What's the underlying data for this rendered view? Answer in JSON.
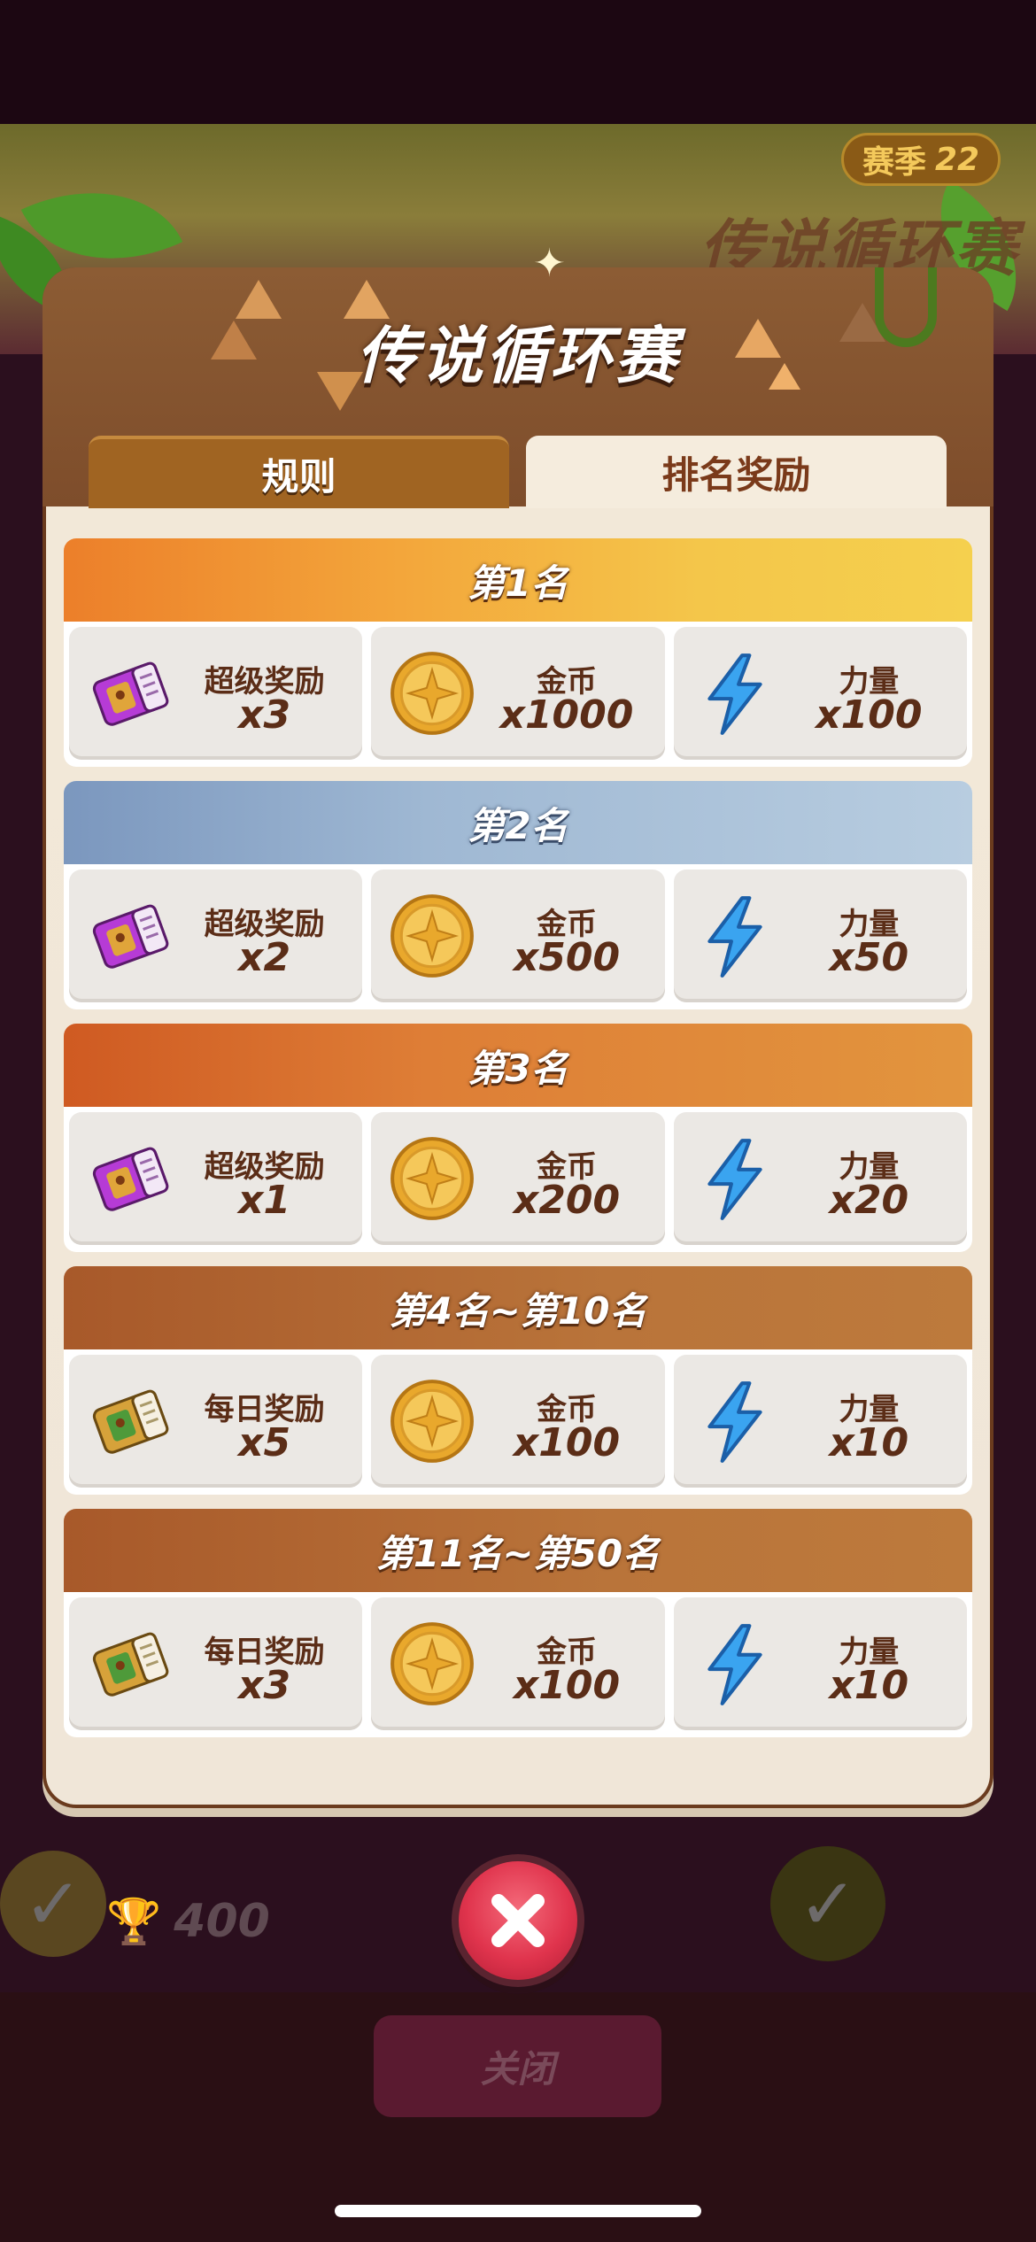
{
  "background": {
    "season_label": "赛季",
    "season_number": "22",
    "event_title": "传说循环赛",
    "trophy_count": "400",
    "close_label": "关闭"
  },
  "dialog": {
    "title": "传说循环赛",
    "tabs": [
      {
        "label": "规则",
        "active": false
      },
      {
        "label": "排名奖励",
        "active": true
      }
    ],
    "tiers": [
      {
        "rank": "第1名",
        "style": "gold",
        "rewards": [
          {
            "icon": "super-ticket-icon",
            "name": "超级奖励",
            "qty": "x3"
          },
          {
            "icon": "gold-coin-icon",
            "name": "金币",
            "qty": "x1000"
          },
          {
            "icon": "lightning-icon",
            "name": "力量",
            "qty": "x100"
          }
        ]
      },
      {
        "rank": "第2名",
        "style": "silver",
        "rewards": [
          {
            "icon": "super-ticket-icon",
            "name": "超级奖励",
            "qty": "x2"
          },
          {
            "icon": "gold-coin-icon",
            "name": "金币",
            "qty": "x500"
          },
          {
            "icon": "lightning-icon",
            "name": "力量",
            "qty": "x50"
          }
        ]
      },
      {
        "rank": "第3名",
        "style": "bronze",
        "rewards": [
          {
            "icon": "super-ticket-icon",
            "name": "超级奖励",
            "qty": "x1"
          },
          {
            "icon": "gold-coin-icon",
            "name": "金币",
            "qty": "x200"
          },
          {
            "icon": "lightning-icon",
            "name": "力量",
            "qty": "x20"
          }
        ]
      },
      {
        "rank": "第4名~第10名",
        "style": "brown",
        "rewards": [
          {
            "icon": "daily-ticket-icon",
            "name": "每日奖励",
            "qty": "x5"
          },
          {
            "icon": "gold-coin-icon",
            "name": "金币",
            "qty": "x100"
          },
          {
            "icon": "lightning-icon",
            "name": "力量",
            "qty": "x10"
          }
        ]
      },
      {
        "rank": "第11名~第50名",
        "style": "brown",
        "rewards": [
          {
            "icon": "daily-ticket-icon",
            "name": "每日奖励",
            "qty": "x3"
          },
          {
            "icon": "gold-coin-icon",
            "name": "金币",
            "qty": "x100"
          },
          {
            "icon": "lightning-icon",
            "name": "力量",
            "qty": "x10"
          }
        ]
      }
    ]
  },
  "colors": {
    "text_brown": "#5b2d17",
    "header_gold": "#f4c64a",
    "header_silver": "#9fb8d3",
    "header_bronze": "#de7e36",
    "header_brown": "#b9743a",
    "close_button_red": "#e0344d"
  }
}
